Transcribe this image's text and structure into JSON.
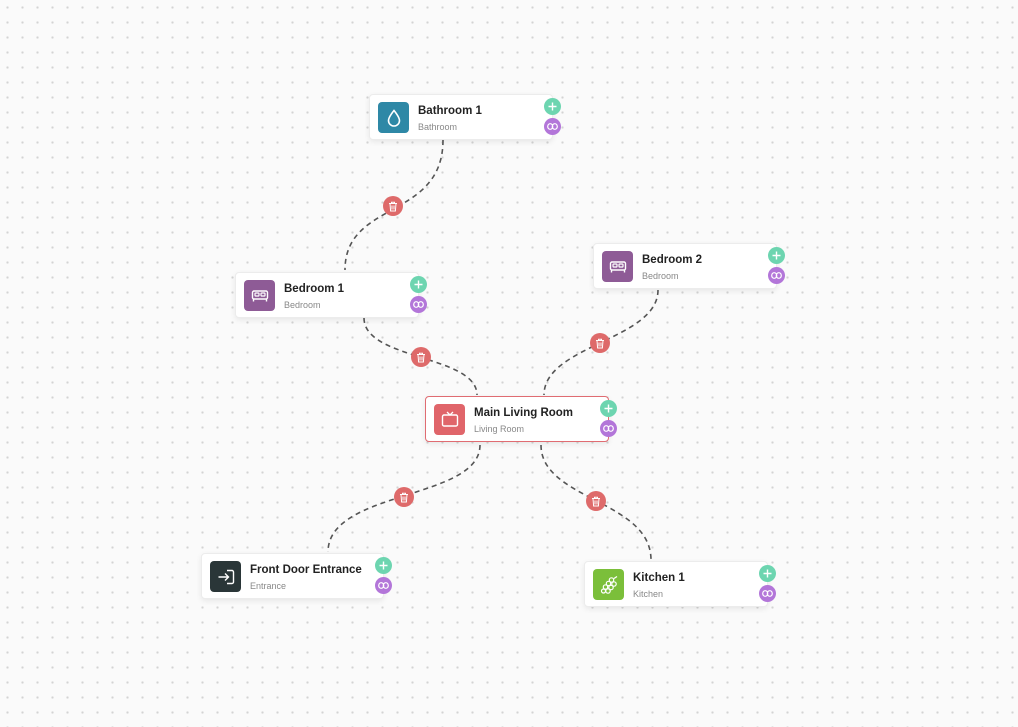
{
  "colors": {
    "canvas_bg": "#fafafa",
    "edge": "#555555",
    "add_button": "#6dd5b0",
    "link_button": "#b376d9",
    "delete_button": "#de6a6a",
    "selected_border": "#e06c72"
  },
  "nodes": [
    {
      "id": "bathroom-1",
      "title": "Bathroom 1",
      "type": "Bathroom",
      "icon": "water-drop-icon",
      "color": "#2e88a6",
      "selected": false
    },
    {
      "id": "bedroom-1",
      "title": "Bedroom 1",
      "type": "Bedroom",
      "icon": "bed-icon",
      "color": "#8e5b96",
      "selected": false
    },
    {
      "id": "bedroom-2",
      "title": "Bedroom 2",
      "type": "Bedroom",
      "icon": "bed-icon",
      "color": "#8e5b96",
      "selected": false
    },
    {
      "id": "main-living-room",
      "title": "Main Living Room",
      "type": "Living Room",
      "icon": "tv-icon",
      "color": "#e0656a",
      "selected": true
    },
    {
      "id": "front-door-entrance",
      "title": "Front Door Entrance",
      "type": "Entrance",
      "icon": "enter-icon",
      "color": "#2a3638",
      "selected": false
    },
    {
      "id": "kitchen-1",
      "title": "Kitchen 1",
      "type": "Kitchen",
      "icon": "grapes-icon",
      "color": "#7bbf3a",
      "selected": false
    }
  ],
  "edges": [
    {
      "from": "bathroom-1",
      "to": "bedroom-1"
    },
    {
      "from": "bedroom-1",
      "to": "main-living-room"
    },
    {
      "from": "bedroom-2",
      "to": "main-living-room"
    },
    {
      "from": "main-living-room",
      "to": "front-door-entrance"
    },
    {
      "from": "main-living-room",
      "to": "kitchen-1"
    }
  ]
}
